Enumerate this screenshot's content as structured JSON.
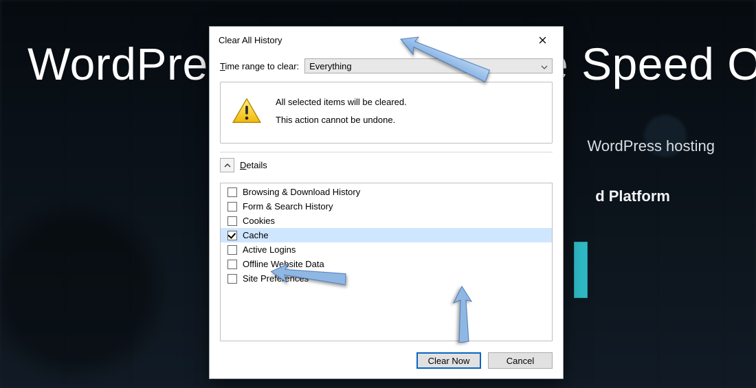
{
  "background": {
    "hero_title": "WordPress Hosting At The Speed Of",
    "sub_line": "WordPress hosting",
    "platform_line": "d Platform"
  },
  "dialog": {
    "title": "Clear All History",
    "time_label_prefix": "T",
    "time_label_rest": "ime range to clear:",
    "time_value": "Everything",
    "warning_line1": "All selected items will be cleared.",
    "warning_line2": "This action cannot be undone.",
    "details_label_prefix": "D",
    "details_label_rest": "etails",
    "items": [
      {
        "label": "Browsing & Download History",
        "checked": false,
        "selected": false
      },
      {
        "label": "Form & Search History",
        "checked": false,
        "selected": false
      },
      {
        "label": "Cookies",
        "checked": false,
        "selected": false
      },
      {
        "label": "Cache",
        "checked": true,
        "selected": true
      },
      {
        "label": "Active Logins",
        "checked": false,
        "selected": false
      },
      {
        "label": "Offline Website Data",
        "checked": false,
        "selected": false
      },
      {
        "label": "Site Preferences",
        "checked": false,
        "selected": false
      }
    ],
    "clear_button": "Clear Now",
    "cancel_button": "Cancel"
  },
  "annotations": {
    "arrow_color": "#8eb7e3",
    "arrow_stroke": "#4f7bb5"
  }
}
